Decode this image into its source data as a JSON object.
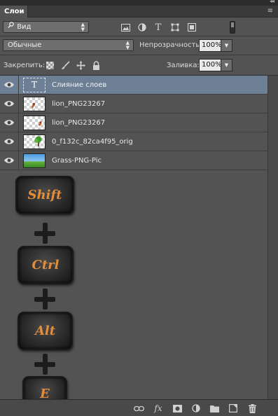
{
  "panel": {
    "tab_label": "Слои",
    "menu_glyph": "≡"
  },
  "filter": {
    "kind_label": "Вид",
    "icons": [
      "image-filter-icon",
      "adjustment-filter-icon",
      "type-filter-icon",
      "shape-filter-icon",
      "smart-object-filter-icon"
    ]
  },
  "blend": {
    "mode": "Обычные",
    "opacity_label": "Непрозрачность:",
    "opacity_value": "100%"
  },
  "lock": {
    "label": "Закрепить:",
    "icons": [
      "lock-transparent-icon",
      "lock-image-icon",
      "lock-position-icon",
      "lock-all-icon"
    ],
    "fill_label": "Заливка:",
    "fill_value": "100%"
  },
  "layers": [
    {
      "name": "Слияние слоев",
      "thumb": "text",
      "thumb_glyph": "T",
      "selected": true
    },
    {
      "name": "lion_PNG23267",
      "thumb": "checker",
      "selected": false
    },
    {
      "name": "lion_PNG23267",
      "thumb": "checker",
      "selected": false
    },
    {
      "name": "0_f132c_82ca4f95_orig",
      "thumb": "checker",
      "selected": false
    },
    {
      "name": "Grass-PNG-Pic",
      "thumb": "grass",
      "selected": false
    }
  ],
  "overlay_keys": [
    "Shift",
    "Ctrl",
    "Alt",
    "E"
  ],
  "bottom_icons": [
    "link-layers-icon",
    "fx-icon",
    "mask-icon",
    "adjustment-layer-icon",
    "group-folder-icon",
    "new-layer-icon",
    "delete-trash-icon"
  ],
  "footer": {
    "fx_label": "fx"
  },
  "colors": {
    "panel_bg": "#535353",
    "selected_row": "#6d7f95",
    "key_text": "#e38d3a"
  }
}
